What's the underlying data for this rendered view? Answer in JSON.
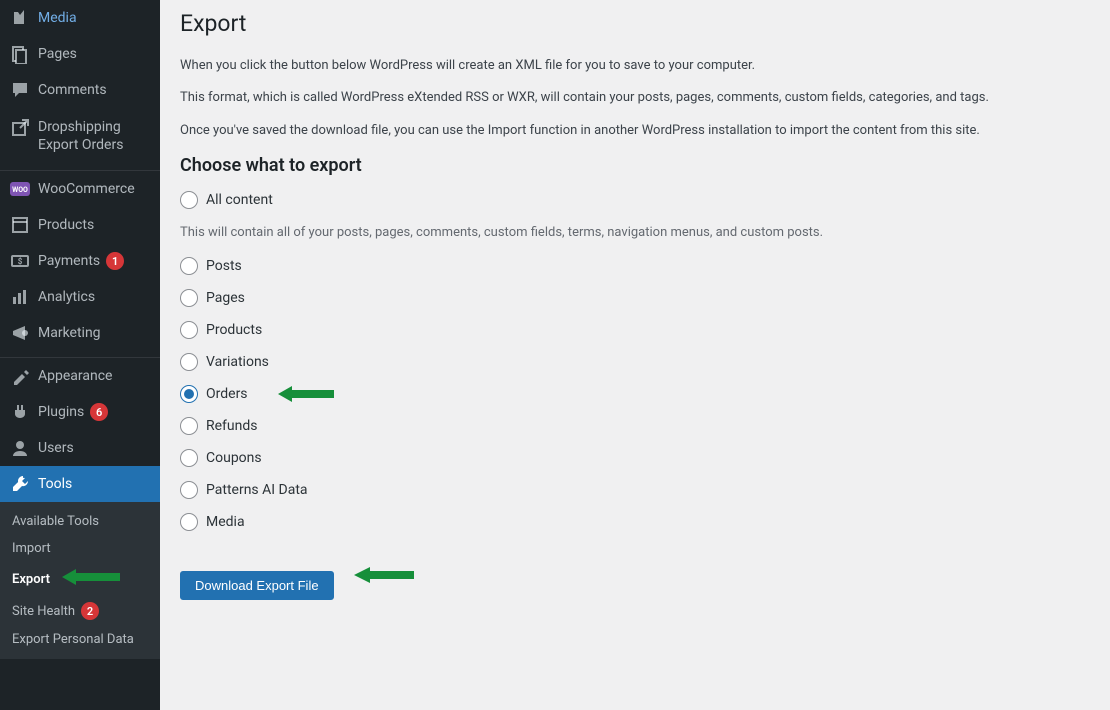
{
  "page": {
    "title": "Export",
    "intro": [
      "When you click the button below WordPress will create an XML file for you to save to your computer.",
      "This format, which is called WordPress eXtended RSS or WXR, will contain your posts, pages, comments, custom fields, categories, and tags.",
      "Once you've saved the download file, you can use the Import function in another WordPress installation to import the content from this site."
    ],
    "section_heading": "Choose what to export",
    "all_content_hint": "This will contain all of your posts, pages, comments, custom fields, terms, navigation menus, and custom posts.",
    "download_button": "Download Export File"
  },
  "export_options": [
    {
      "label": "All content",
      "checked": false,
      "arrow": false
    },
    {
      "label": "Posts",
      "checked": false,
      "arrow": false
    },
    {
      "label": "Pages",
      "checked": false,
      "arrow": false
    },
    {
      "label": "Products",
      "checked": false,
      "arrow": false
    },
    {
      "label": "Variations",
      "checked": false,
      "arrow": false
    },
    {
      "label": "Orders",
      "checked": true,
      "arrow": true
    },
    {
      "label": "Refunds",
      "checked": false,
      "arrow": false
    },
    {
      "label": "Coupons",
      "checked": false,
      "arrow": false
    },
    {
      "label": "Patterns AI Data",
      "checked": false,
      "arrow": false
    },
    {
      "label": "Media",
      "checked": false,
      "arrow": false
    }
  ],
  "sidebar": {
    "items": [
      {
        "icon": "media",
        "label": "Media",
        "badge": null,
        "active": false,
        "multiline": false
      },
      {
        "icon": "page",
        "label": "Pages",
        "badge": null,
        "active": false,
        "multiline": false
      },
      {
        "icon": "comment",
        "label": "Comments",
        "badge": null,
        "active": false,
        "multiline": false
      },
      {
        "icon": "external",
        "label": "Dropshipping Export Orders",
        "badge": null,
        "active": false,
        "multiline": true
      },
      {
        "icon": "woo",
        "label": "WooCommerce",
        "badge": null,
        "active": false,
        "multiline": false
      },
      {
        "icon": "products",
        "label": "Products",
        "badge": null,
        "active": false,
        "multiline": false
      },
      {
        "icon": "payments",
        "label": "Payments",
        "badge": "1",
        "active": false,
        "multiline": false
      },
      {
        "icon": "analytics",
        "label": "Analytics",
        "badge": null,
        "active": false,
        "multiline": false
      },
      {
        "icon": "marketing",
        "label": "Marketing",
        "badge": null,
        "active": false,
        "multiline": false
      },
      {
        "icon": "appearance",
        "label": "Appearance",
        "badge": null,
        "active": false,
        "multiline": false
      },
      {
        "icon": "plugins",
        "label": "Plugins",
        "badge": "6",
        "active": false,
        "multiline": false
      },
      {
        "icon": "users",
        "label": "Users",
        "badge": null,
        "active": false,
        "multiline": false
      },
      {
        "icon": "tools",
        "label": "Tools",
        "badge": null,
        "active": true,
        "multiline": false
      }
    ],
    "submenu": [
      {
        "label": "Available Tools",
        "current": false,
        "badge": null,
        "arrow": false
      },
      {
        "label": "Import",
        "current": false,
        "badge": null,
        "arrow": false
      },
      {
        "label": "Export",
        "current": true,
        "badge": null,
        "arrow": true
      },
      {
        "label": "Site Health",
        "current": false,
        "badge": "2",
        "arrow": false
      },
      {
        "label": "Export Personal Data",
        "current": false,
        "badge": null,
        "arrow": false
      }
    ]
  }
}
